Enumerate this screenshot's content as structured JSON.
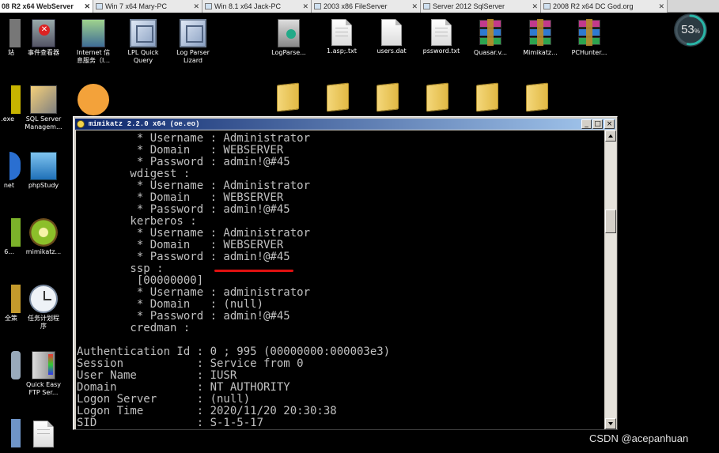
{
  "tabs": [
    {
      "label": "08 R2 x64 WebServer",
      "active": true
    },
    {
      "label": "Win 7 x64 Mary-PC",
      "active": false
    },
    {
      "label": "Win 8.1 x64 Jack-PC",
      "active": false
    },
    {
      "label": "2003 x86 FileServer",
      "active": false
    },
    {
      "label": "Server 2012 SqlServer",
      "active": false
    },
    {
      "label": "2008 R2 x64 DC God.org",
      "active": false
    }
  ],
  "desktop_icons": {
    "zhan": "站",
    "event_viewer": "事件查看器",
    "iis": "Internet 信\n息服务（I...",
    "lpl": "LPL Quick\nQuery",
    "log_parser_lizard": "Log Parser\nLizard",
    "logparse": "LogParse...",
    "asp_txt": "1.asp;.txt",
    "users_dat": "users.dat",
    "pssword_txt": "pssword.txt",
    "quasar": "Quasar.v...",
    "mimikatz_rar": "Mimikatz...",
    "pchunter": "PCHunter...",
    "exe": ".exe",
    "sql_mgmt": "SQL Server\nManagem...",
    "net": "net",
    "phpstudy": "phpStudy",
    "num6": "6...",
    "mimikatz_kiwi": "mimikatz...",
    "anquan": "全策",
    "task_scheduler": "任务计划程\n序",
    "quick_easy_ftp": "Quick Easy\nFTP Ser..."
  },
  "console": {
    "title": "mimikatz 2.2.0 x64 (oe.eo)",
    "lines": [
      "         * Username : Administrator",
      "         * Domain   : WEBSERVER",
      "         * Password : admin!@#45",
      "        wdigest :",
      "         * Username : Administrator",
      "         * Domain   : WEBSERVER",
      "         * Password : admin!@#45",
      "        kerberos :",
      "         * Username : Administrator",
      "         * Domain   : WEBSERVER",
      "         * Password : admin!@#45",
      "        ssp :",
      "         [00000000]",
      "         * Username : administrator",
      "         * Domain   : (null)",
      "         * Password : admin!@#45",
      "        credman :",
      "",
      "Authentication Id : 0 ; 995 (00000000:000003e3)",
      "Session           : Service from 0",
      "User Name         : IUSR",
      "Domain            : NT AUTHORITY",
      "Logon Server      : (null)",
      "Logon Time        : 2020/11/20 20:30:38",
      "SID               : S-1-5-17"
    ],
    "buttons": {
      "minimize": "_",
      "maximize": "□",
      "close": "×"
    }
  },
  "gauge": {
    "value": "53",
    "unit": "%"
  },
  "watermark": "CSDN @acepanhuan"
}
